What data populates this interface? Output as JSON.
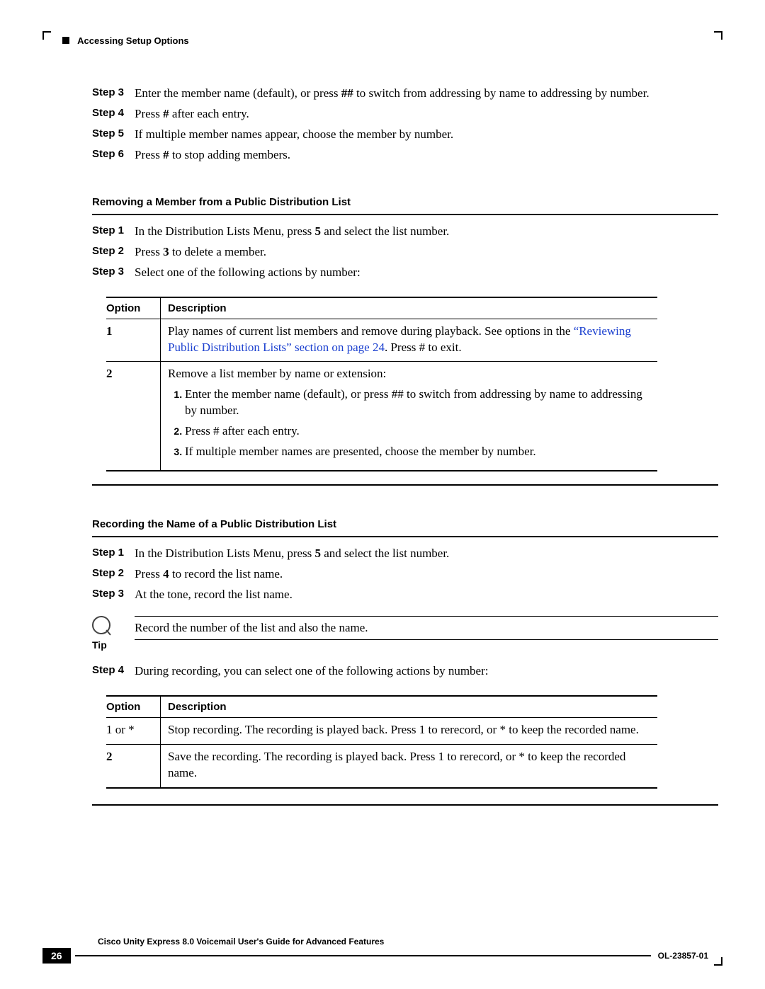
{
  "running_head": "Accessing Setup Options",
  "steps_a": [
    {
      "label": "Step 3",
      "text": "Enter the member name (default), or press ## to switch from addressing by name to addressing by number."
    },
    {
      "label": "Step 4",
      "text": "Press # after each entry."
    },
    {
      "label": "Step 5",
      "text": "If multiple member names appear, choose the member by number."
    },
    {
      "label": "Step 6",
      "text": "Press # to stop adding members."
    }
  ],
  "heading_b": "Removing a Member from a Public Distribution List",
  "steps_b": [
    {
      "label": "Step 1",
      "text": "In the Distribution Lists Menu, press 5 and select the list number."
    },
    {
      "label": "Step 2",
      "text": "Press 3 to delete a member."
    },
    {
      "label": "Step 3",
      "text": "Select one of the following actions by number:"
    }
  ],
  "table_b": {
    "head": {
      "opt": "Option",
      "desc": "Description"
    },
    "rows": [
      {
        "opt": "1",
        "desc_pre": "Play names of current list members and remove during playback. See options in the ",
        "link": "“Reviewing Public Distribution Lists” section on page 24",
        "desc_post": ". Press # to exit."
      },
      {
        "opt": "2",
        "lead": "Remove a list member by name or extension:",
        "items": [
          "Enter the member name (default), or press ## to switch from addressing by name to addressing by number.",
          "Press # after each entry.",
          "If multiple member names are presented, choose the member by number."
        ]
      }
    ]
  },
  "heading_c": "Recording the Name of a Public Distribution List",
  "steps_c": [
    {
      "label": "Step 1",
      "text": "In the Distribution Lists Menu, press 5 and select the list number."
    },
    {
      "label": "Step 2",
      "text": "Press 4 to record the list name."
    },
    {
      "label": "Step 3",
      "text": "At the tone, record the list name."
    }
  ],
  "tip": {
    "label": "Tip",
    "text": "Record the number of the list and also the name."
  },
  "steps_c2": [
    {
      "label": "Step 4",
      "text": "During recording, you can select one of the following actions by number:"
    }
  ],
  "table_c": {
    "head": {
      "opt": "Option",
      "desc": "Description"
    },
    "rows": [
      {
        "opt": "1 or *",
        "desc": "Stop recording. The recording is played back. Press 1 to rerecord, or * to keep the recorded name."
      },
      {
        "opt": "2",
        "desc": "Save the recording. The recording is played back. Press 1 to rerecord, or * to keep the recorded name."
      }
    ]
  },
  "footer": {
    "title": "Cisco Unity Express 8.0 Voicemail User's Guide for Advanced Features",
    "page": "26",
    "doc_id": "OL-23857-01"
  }
}
